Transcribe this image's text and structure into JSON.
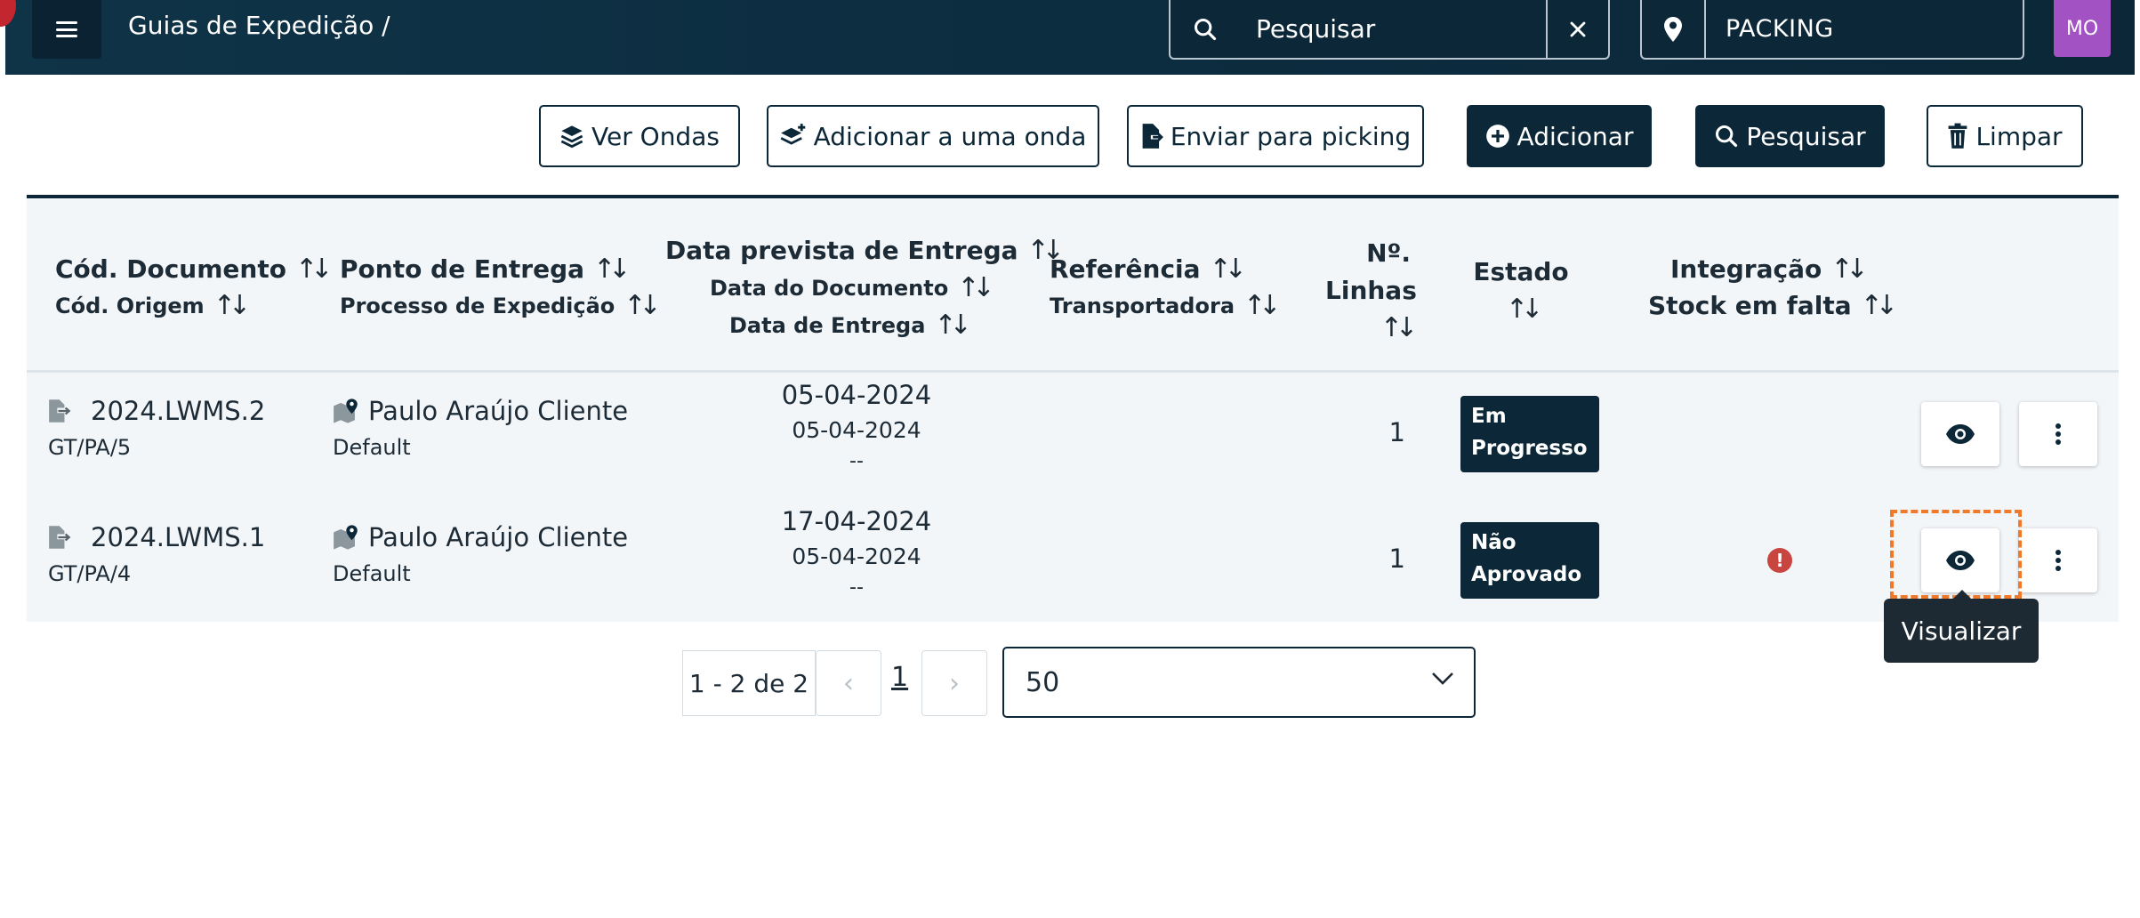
{
  "topbar": {
    "breadcrumb": "Guias de Expedição  /",
    "search_placeholder": "Pesquisar",
    "location": "PACKING",
    "avatar_initials": "MO"
  },
  "toolbar": {
    "view_waves": "Ver Ondas",
    "add_to_wave": "Adicionar a uma onda",
    "send_picking": "Enviar para picking",
    "add": "Adicionar",
    "search": "Pesquisar",
    "clear": "Limpar"
  },
  "table": {
    "headers": {
      "doc_code": "Cód. Documento",
      "origin_code": "Cód. Origem",
      "delivery_point": "Ponto de Entrega",
      "shipping_process": "Processo de Expedição",
      "expected_date": "Data prevista de Entrega",
      "doc_date": "Data do Documento",
      "delivery_date": "Data de Entrega",
      "reference": "Referência",
      "carrier": "Transportadora",
      "lines_1": "Nº.",
      "lines_2": "Linhas",
      "status": "Estado",
      "integration": "Integração",
      "missing_stock": "Stock em falta"
    },
    "rows": [
      {
        "doc": "2024.LWMS.2",
        "origin": "GT/PA/5",
        "client": "Paulo Araújo Cliente",
        "process": "Default",
        "expected_date": "05-04-2024",
        "doc_date": "05-04-2024",
        "delivery_date": "--",
        "lines": "1",
        "status_1": "Em",
        "status_2": "Progresso",
        "warning": ""
      },
      {
        "doc": "2024.LWMS.1",
        "origin": "GT/PA/4",
        "client": "Paulo Araújo Cliente",
        "process": "Default",
        "expected_date": "17-04-2024",
        "doc_date": "05-04-2024",
        "delivery_date": "--",
        "lines": "1",
        "status_1": "Não",
        "status_2": "Aprovado",
        "warning": "!"
      }
    ]
  },
  "tooltip": "Visualizar",
  "pagination": {
    "count": "1 - 2 de 2",
    "prev": "‹",
    "page": "1",
    "next": "›",
    "page_size": "50"
  },
  "colors": {
    "primary": "#0b2738",
    "avatar": "#a352c4",
    "warning": "#c9453f",
    "highlight": "#f07a2a"
  }
}
